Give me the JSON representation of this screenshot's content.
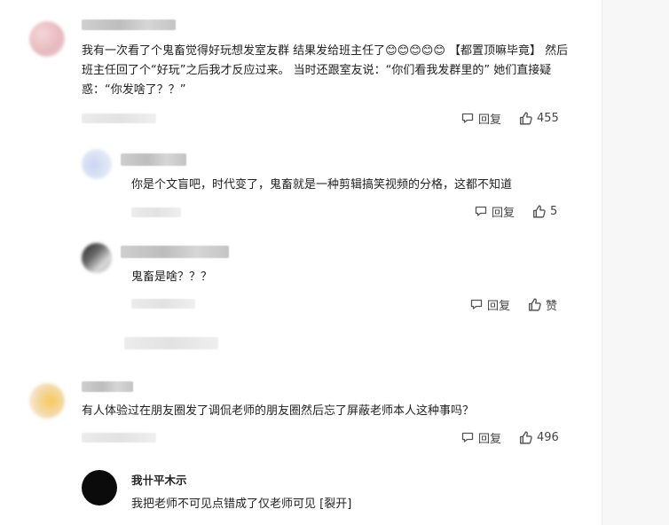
{
  "comments": [
    {
      "text": "我有一次看了个鬼畜觉得好玩想发室友群 结果发给班主任了😊😊😊😊😊 【都置顶嘛毕竟】 然后班主任回了个“好玩”之后我才反应过来。 当时还跟室友说：“你们看我发群里的” 她们直接疑惑：“你发啥了？？”",
      "reply_label": "回复",
      "like_count": "455"
    },
    {
      "text": "你是个文盲吧，时代变了，鬼畜就是一种剪辑搞笑视频的分格，这都不知道",
      "reply_label": "回复",
      "like_count": "5"
    },
    {
      "text": "鬼畜是啥？？？",
      "reply_label": "回复",
      "like_count": "赞"
    },
    {
      "text": "有人体验过在朋友圈发了调侃老师的朋友圈然后忘了屏蔽老师本人这种事吗？",
      "reply_label": "回复",
      "like_count": "496"
    },
    {
      "username": "我卄平木示",
      "text": "我把老师不可见点错成了仅老师可见 [裂开]"
    }
  ]
}
